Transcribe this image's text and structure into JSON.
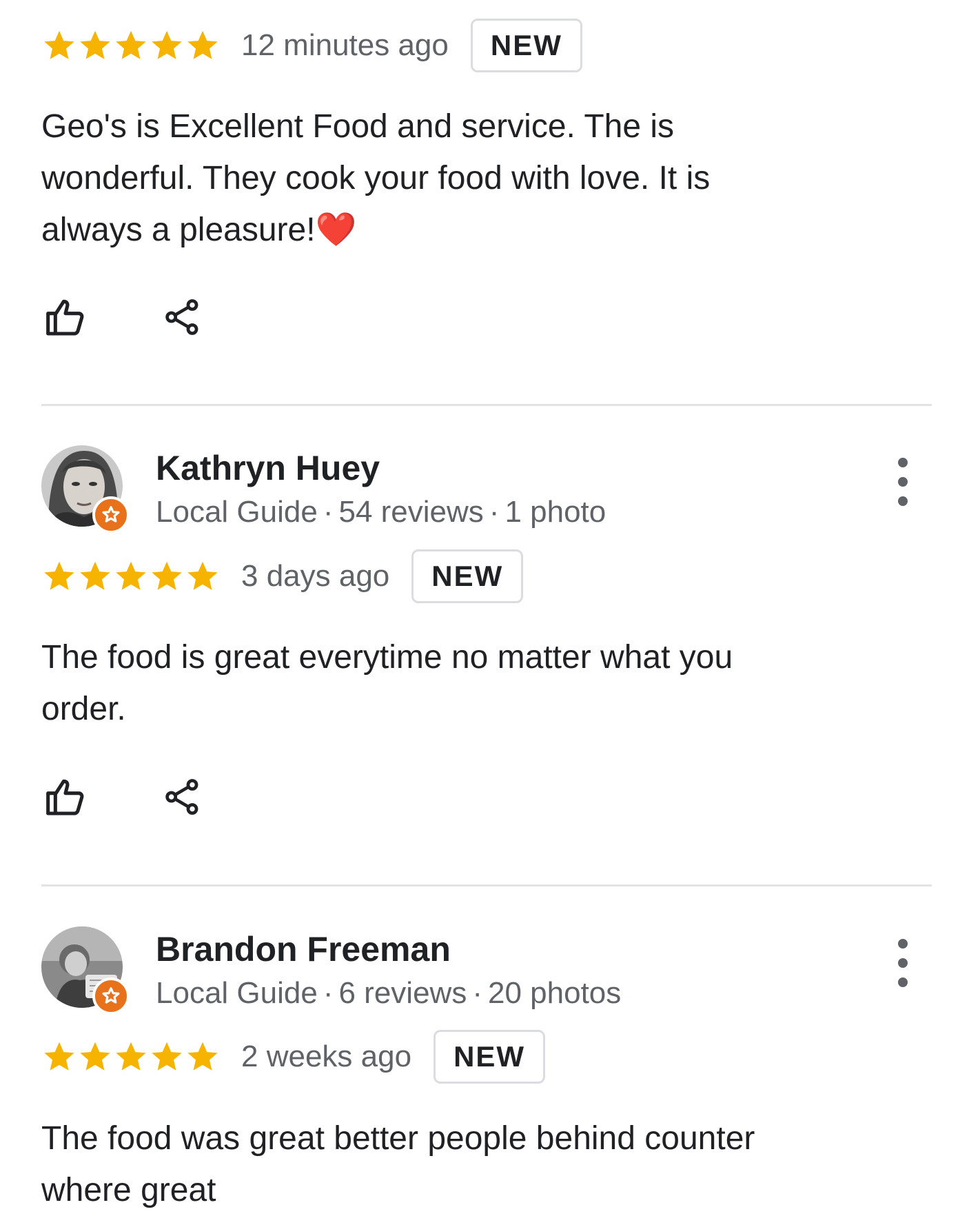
{
  "colors": {
    "star": "#f6b400",
    "text": "#202124",
    "muted": "#5f6368",
    "guide_badge": "#e8711c",
    "divider": "#e3e3e3"
  },
  "reviews": [
    {
      "rating": 5,
      "time": "12 minutes ago",
      "badge": "NEW",
      "text": "Geo's is Excellent Food and service. The is wonderful. They cook your food with love. It is always a pleasure!❤️"
    },
    {
      "author": {
        "name": "Kathryn Huey",
        "role": "Local Guide",
        "reviews": "54 reviews",
        "photos": "1 photo",
        "avatar": "portrait-avatar"
      },
      "rating": 5,
      "time": "3 days ago",
      "badge": "NEW",
      "text": "The food is great everytime no matter what you order."
    },
    {
      "author": {
        "name": "Brandon Freeman",
        "role": "Local Guide",
        "reviews": "6 reviews",
        "photos": "20 photos",
        "avatar": "portrait-avatar"
      },
      "rating": 5,
      "time": "2 weeks ago",
      "badge": "NEW",
      "text": "The food was great better people behind counter where great"
    }
  ],
  "separator": "·",
  "icons": {
    "like": "thumbs-up-icon",
    "share": "share-icon",
    "more": "more-vert-icon",
    "star": "star-icon",
    "guide": "local-guide-star-icon"
  }
}
